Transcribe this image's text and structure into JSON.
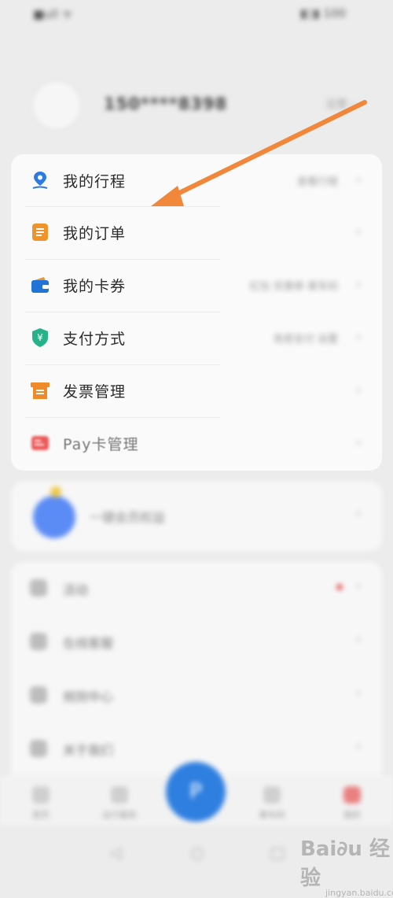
{
  "status_bar": {
    "left_text": "■ull ᯤ",
    "right_text": "▮▯▮ 100"
  },
  "profile": {
    "phone": "150****8398",
    "action": "设置 ›"
  },
  "menu": {
    "items": [
      {
        "label": "我的行程",
        "icon": "location-pin-icon",
        "right_text": "查看行程"
      },
      {
        "label": "我的订单",
        "icon": "order-list-icon",
        "right_text": ""
      },
      {
        "label": "我的卡券",
        "icon": "wallet-icon",
        "right_text": "红包 优惠券 乘车码"
      },
      {
        "label": "支付方式",
        "icon": "shield-yuan-icon",
        "right_text": "免密支付 设置"
      },
      {
        "label": "发票管理",
        "icon": "invoice-icon",
        "right_text": ""
      },
      {
        "label": "Pay卡管理",
        "icon": "pay-card-icon",
        "right_text": ""
      }
    ],
    "chevron": "›"
  },
  "vip": {
    "text": "一键会员权益",
    "chevron": "›"
  },
  "other": {
    "rows": [
      {
        "label": "活动",
        "icon": "gift-icon",
        "badge": true
      },
      {
        "label": "在线客服",
        "icon": "chat-icon",
        "badge": false
      },
      {
        "label": "规则中心",
        "icon": "book-icon",
        "badge": false
      },
      {
        "label": "关于我们",
        "icon": "info-icon",
        "badge": false
      }
    ],
    "chevron": "›"
  },
  "tabs": [
    {
      "label": "首页",
      "icon": "home-icon"
    },
    {
      "label": "出行服务",
      "icon": "car-icon"
    },
    {
      "label": "乘车码",
      "icon": "qr-icon"
    },
    {
      "label": "我的",
      "icon": "user-icon"
    }
  ],
  "fab": {
    "glyph": "P",
    "icon": "pay-icon"
  },
  "system_nav": {
    "back": "◁",
    "home": "○",
    "recent": "□"
  },
  "annotation": {
    "arrow_color": "#f0873a"
  },
  "watermark": {
    "logo_text": "Bai∂u 经验",
    "sub_text": "jingyan.baidu.com"
  },
  "colors": {
    "pin_blue": "#2c7be5",
    "order_orange": "#f0932b",
    "wallet_blue": "#1f74d6",
    "shield_green": "#26b38a",
    "invoice_orange": "#ef8a2b",
    "paycard_red": "#ec5a5a"
  }
}
